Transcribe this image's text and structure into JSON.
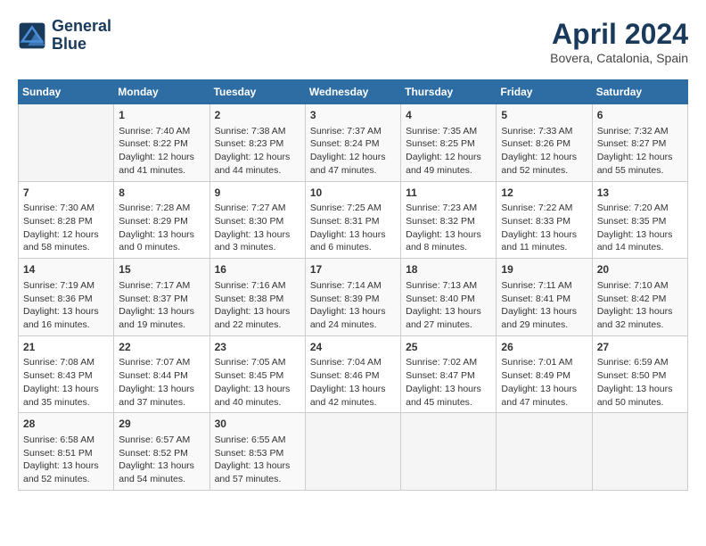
{
  "logo": {
    "line1": "General",
    "line2": "Blue"
  },
  "title": "April 2024",
  "subtitle": "Bovera, Catalonia, Spain",
  "header_days": [
    "Sunday",
    "Monday",
    "Tuesday",
    "Wednesday",
    "Thursday",
    "Friday",
    "Saturday"
  ],
  "weeks": [
    [
      {
        "day": "",
        "info": ""
      },
      {
        "day": "1",
        "info": "Sunrise: 7:40 AM\nSunset: 8:22 PM\nDaylight: 12 hours\nand 41 minutes."
      },
      {
        "day": "2",
        "info": "Sunrise: 7:38 AM\nSunset: 8:23 PM\nDaylight: 12 hours\nand 44 minutes."
      },
      {
        "day": "3",
        "info": "Sunrise: 7:37 AM\nSunset: 8:24 PM\nDaylight: 12 hours\nand 47 minutes."
      },
      {
        "day": "4",
        "info": "Sunrise: 7:35 AM\nSunset: 8:25 PM\nDaylight: 12 hours\nand 49 minutes."
      },
      {
        "day": "5",
        "info": "Sunrise: 7:33 AM\nSunset: 8:26 PM\nDaylight: 12 hours\nand 52 minutes."
      },
      {
        "day": "6",
        "info": "Sunrise: 7:32 AM\nSunset: 8:27 PM\nDaylight: 12 hours\nand 55 minutes."
      }
    ],
    [
      {
        "day": "7",
        "info": "Sunrise: 7:30 AM\nSunset: 8:28 PM\nDaylight: 12 hours\nand 58 minutes."
      },
      {
        "day": "8",
        "info": "Sunrise: 7:28 AM\nSunset: 8:29 PM\nDaylight: 13 hours\nand 0 minutes."
      },
      {
        "day": "9",
        "info": "Sunrise: 7:27 AM\nSunset: 8:30 PM\nDaylight: 13 hours\nand 3 minutes."
      },
      {
        "day": "10",
        "info": "Sunrise: 7:25 AM\nSunset: 8:31 PM\nDaylight: 13 hours\nand 6 minutes."
      },
      {
        "day": "11",
        "info": "Sunrise: 7:23 AM\nSunset: 8:32 PM\nDaylight: 13 hours\nand 8 minutes."
      },
      {
        "day": "12",
        "info": "Sunrise: 7:22 AM\nSunset: 8:33 PM\nDaylight: 13 hours\nand 11 minutes."
      },
      {
        "day": "13",
        "info": "Sunrise: 7:20 AM\nSunset: 8:35 PM\nDaylight: 13 hours\nand 14 minutes."
      }
    ],
    [
      {
        "day": "14",
        "info": "Sunrise: 7:19 AM\nSunset: 8:36 PM\nDaylight: 13 hours\nand 16 minutes."
      },
      {
        "day": "15",
        "info": "Sunrise: 7:17 AM\nSunset: 8:37 PM\nDaylight: 13 hours\nand 19 minutes."
      },
      {
        "day": "16",
        "info": "Sunrise: 7:16 AM\nSunset: 8:38 PM\nDaylight: 13 hours\nand 22 minutes."
      },
      {
        "day": "17",
        "info": "Sunrise: 7:14 AM\nSunset: 8:39 PM\nDaylight: 13 hours\nand 24 minutes."
      },
      {
        "day": "18",
        "info": "Sunrise: 7:13 AM\nSunset: 8:40 PM\nDaylight: 13 hours\nand 27 minutes."
      },
      {
        "day": "19",
        "info": "Sunrise: 7:11 AM\nSunset: 8:41 PM\nDaylight: 13 hours\nand 29 minutes."
      },
      {
        "day": "20",
        "info": "Sunrise: 7:10 AM\nSunset: 8:42 PM\nDaylight: 13 hours\nand 32 minutes."
      }
    ],
    [
      {
        "day": "21",
        "info": "Sunrise: 7:08 AM\nSunset: 8:43 PM\nDaylight: 13 hours\nand 35 minutes."
      },
      {
        "day": "22",
        "info": "Sunrise: 7:07 AM\nSunset: 8:44 PM\nDaylight: 13 hours\nand 37 minutes."
      },
      {
        "day": "23",
        "info": "Sunrise: 7:05 AM\nSunset: 8:45 PM\nDaylight: 13 hours\nand 40 minutes."
      },
      {
        "day": "24",
        "info": "Sunrise: 7:04 AM\nSunset: 8:46 PM\nDaylight: 13 hours\nand 42 minutes."
      },
      {
        "day": "25",
        "info": "Sunrise: 7:02 AM\nSunset: 8:47 PM\nDaylight: 13 hours\nand 45 minutes."
      },
      {
        "day": "26",
        "info": "Sunrise: 7:01 AM\nSunset: 8:49 PM\nDaylight: 13 hours\nand 47 minutes."
      },
      {
        "day": "27",
        "info": "Sunrise: 6:59 AM\nSunset: 8:50 PM\nDaylight: 13 hours\nand 50 minutes."
      }
    ],
    [
      {
        "day": "28",
        "info": "Sunrise: 6:58 AM\nSunset: 8:51 PM\nDaylight: 13 hours\nand 52 minutes."
      },
      {
        "day": "29",
        "info": "Sunrise: 6:57 AM\nSunset: 8:52 PM\nDaylight: 13 hours\nand 54 minutes."
      },
      {
        "day": "30",
        "info": "Sunrise: 6:55 AM\nSunset: 8:53 PM\nDaylight: 13 hours\nand 57 minutes."
      },
      {
        "day": "",
        "info": ""
      },
      {
        "day": "",
        "info": ""
      },
      {
        "day": "",
        "info": ""
      },
      {
        "day": "",
        "info": ""
      }
    ]
  ]
}
